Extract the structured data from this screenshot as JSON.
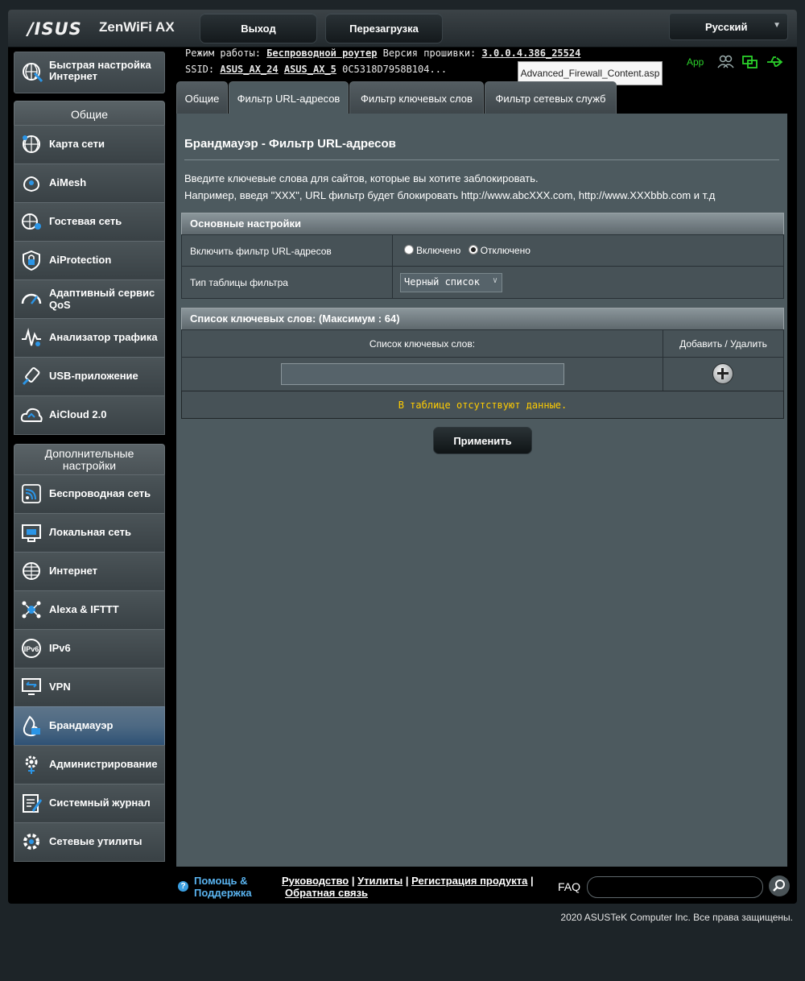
{
  "header": {
    "brand": "/ISUS",
    "model": "ZenWiFi AX",
    "logout_label": "Выход",
    "reboot_label": "Перезагрузка",
    "language": "Русский"
  },
  "status": {
    "mode_label": "Режим работы:",
    "mode_value": "Беспроводной роутер",
    "firmware_label": "Версия прошивки:",
    "firmware_value": "3.0.0.4.386_25524",
    "ssid_label": "SSID:",
    "ssid_24": "ASUS_AX_24",
    "ssid_5": "ASUS_AX_5",
    "ssid_extra": "0C5318D7958B104...",
    "app_label": "App",
    "tooltip": "Advanced_Firewall_Content.asp"
  },
  "sidebar": {
    "quick_setup": "Быстрая настройка Интернет",
    "general_title": "Общие",
    "general_items": [
      {
        "label": "Карта сети",
        "icon": "globe-network-icon"
      },
      {
        "label": "AiMesh",
        "icon": "mesh-icon"
      },
      {
        "label": "Гостевая сеть",
        "icon": "guest-network-icon"
      },
      {
        "label": "AiProtection",
        "icon": "shield-lock-icon"
      },
      {
        "label": "Адаптивный сервис QoS",
        "icon": "gauge-icon"
      },
      {
        "label": "Анализатор трафика",
        "icon": "traffic-analyzer-icon"
      },
      {
        "label": "USB-приложение",
        "icon": "usb-icon"
      },
      {
        "label": "AiCloud 2.0",
        "icon": "cloud-icon"
      }
    ],
    "advanced_title": "Дополнительные настройки",
    "advanced_items": [
      {
        "label": "Беспроводная сеть",
        "icon": "wireless-icon"
      },
      {
        "label": "Локальная сеть",
        "icon": "lan-icon"
      },
      {
        "label": "Интернет",
        "icon": "internet-globe-icon"
      },
      {
        "label": "Alexa & IFTTT",
        "icon": "alexa-icon"
      },
      {
        "label": "IPv6",
        "icon": "ipv6-icon"
      },
      {
        "label": "VPN",
        "icon": "vpn-icon"
      },
      {
        "label": "Брандмауэр",
        "icon": "firewall-icon",
        "active": true
      },
      {
        "label": "Администрирование",
        "icon": "admin-gear-icon"
      },
      {
        "label": "Системный журнал",
        "icon": "log-icon"
      },
      {
        "label": "Сетевые утилиты",
        "icon": "tools-icon"
      }
    ]
  },
  "tabs": [
    {
      "label": "Общие"
    },
    {
      "label": "Фильтр URL-адресов",
      "active": true
    },
    {
      "label": "Фильтр ключевых слов"
    },
    {
      "label": "Фильтр сетевых служб"
    }
  ],
  "main": {
    "title": "Брандмауэр - Фильтр URL-адресов",
    "desc1": "Введите ключевые слова для сайтов, которые вы хотите заблокировать.",
    "desc2": "Например, введя \"XXX\", URL фильтр будет блокировать http://www.abcXXX.com, http://www.XXXbbb.com и т.д",
    "basic_section": "Основные настройки",
    "enable_label": "Включить фильтр URL-адресов",
    "radio_on": "Включено",
    "radio_off": "Отключено",
    "radio_selected": "Отключено",
    "table_type_label": "Тип таблицы фильтра",
    "table_type_value": "Черный список",
    "list_section": "Список ключевых слов: (Максимум : 64)",
    "col_keywords": "Список ключевых слов:",
    "col_action": "Добавить / Удалить",
    "keyword_value": "",
    "no_data": "В таблице отсутствуют данные.",
    "apply_label": "Применить"
  },
  "footer": {
    "help": "Помощь & Поддержка",
    "link_manual": "Руководство",
    "link_utils": "Утилиты",
    "link_register": "Регистрация продукта",
    "link_feedback": "Обратная связь",
    "faq_label": "FAQ",
    "faq_value": "",
    "copyright": "2020 ASUSTeK Computer Inc. Все права защищены."
  },
  "colors": {
    "accent_green": "#2bd12b",
    "warning_yellow": "#ffcc00",
    "help_blue": "#5ab4f0"
  }
}
